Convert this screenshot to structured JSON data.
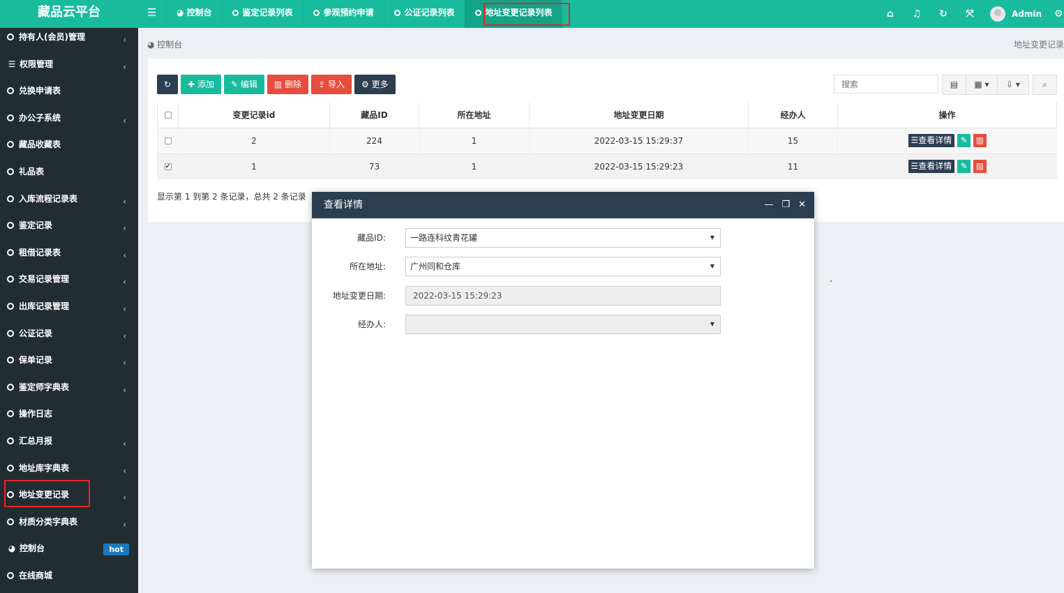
{
  "app": {
    "title": "藏品云平台"
  },
  "topnav": {
    "tabs": [
      {
        "label": "控制台",
        "icon": "dashboard-icon"
      },
      {
        "label": "鉴定记录列表",
        "icon": "circle-icon"
      },
      {
        "label": "参观预约申请",
        "icon": "circle-icon"
      },
      {
        "label": "公证记录列表",
        "icon": "circle-icon"
      },
      {
        "label": "地址变更记录列表",
        "icon": "circle-icon",
        "active": true
      }
    ],
    "icons": [
      "home-icon",
      "bell-icon",
      "refresh-icon",
      "fullscreen-icon"
    ],
    "user": "Admin"
  },
  "sidebar": {
    "items": [
      {
        "label": "持有人(会员)管理",
        "icon": "circle-icon",
        "chevron": true
      },
      {
        "label": "权限管理",
        "icon": "list-icon",
        "chevron": true
      },
      {
        "label": "兑换申请表",
        "icon": "circle-icon",
        "chevron": false
      },
      {
        "label": "办公子系统",
        "icon": "circle-icon",
        "chevron": true
      },
      {
        "label": "藏品收藏表",
        "icon": "circle-icon",
        "chevron": false
      },
      {
        "label": "礼品表",
        "icon": "circle-icon",
        "chevron": false
      },
      {
        "label": "入库流程记录表",
        "icon": "circle-icon",
        "chevron": true
      },
      {
        "label": "鉴定记录",
        "icon": "circle-icon",
        "chevron": true
      },
      {
        "label": "租借记录表",
        "icon": "circle-icon",
        "chevron": true
      },
      {
        "label": "交易记录管理",
        "icon": "circle-icon",
        "chevron": true
      },
      {
        "label": "出库记录管理",
        "icon": "circle-icon",
        "chevron": true
      },
      {
        "label": "公证记录",
        "icon": "circle-icon",
        "chevron": true
      },
      {
        "label": "保单记录",
        "icon": "circle-icon",
        "chevron": true
      },
      {
        "label": "鉴定师字典表",
        "icon": "circle-icon",
        "chevron": true
      },
      {
        "label": "操作日志",
        "icon": "circle-icon",
        "chevron": false
      },
      {
        "label": "汇总月报",
        "icon": "circle-icon",
        "chevron": true
      },
      {
        "label": "地址库字典表",
        "icon": "circle-icon",
        "chevron": true
      },
      {
        "label": "地址变更记录",
        "icon": "circle-icon",
        "chevron": true
      },
      {
        "label": "材质分类字典表",
        "icon": "circle-icon",
        "chevron": true
      },
      {
        "label": "控制台",
        "icon": "dashboard-icon",
        "chevron": false,
        "badge": "hot"
      },
      {
        "label": "在线商城",
        "icon": "circle-icon",
        "chevron": false
      }
    ]
  },
  "breadcrumb": {
    "home": "控制台",
    "right": "地址变更记录"
  },
  "toolbar": {
    "add": "添加",
    "edit": "编辑",
    "delete": "删除",
    "import": "导入",
    "more": "更多",
    "search_placeholder": "搜索"
  },
  "table": {
    "columns": [
      "变更记录id",
      "藏品ID",
      "所在地址",
      "地址变更日期",
      "经办人",
      "操作"
    ],
    "rows": [
      {
        "id": "2",
        "item_id": "224",
        "address": "1",
        "date": "2022-03-15 15:29:37",
        "handler": "15",
        "checked": false
      },
      {
        "id": "1",
        "item_id": "73",
        "address": "1",
        "date": "2022-03-15 15:29:23",
        "handler": "11",
        "checked": true
      }
    ],
    "view_label": "查看详情"
  },
  "pager": "显示第 1 到第 2 条记录，总共 2 条记录",
  "modal": {
    "title": "查看详情",
    "fields": [
      {
        "label": "藏品ID:",
        "value": "一路连科纹青花罐",
        "type": "select"
      },
      {
        "label": "所在地址:",
        "value": "广州同和仓库",
        "type": "select"
      },
      {
        "label": "地址变更日期:",
        "value": "2022-03-15 15:29:23",
        "type": "text"
      },
      {
        "label": "经办人:",
        "value": "",
        "type": "select"
      }
    ]
  }
}
